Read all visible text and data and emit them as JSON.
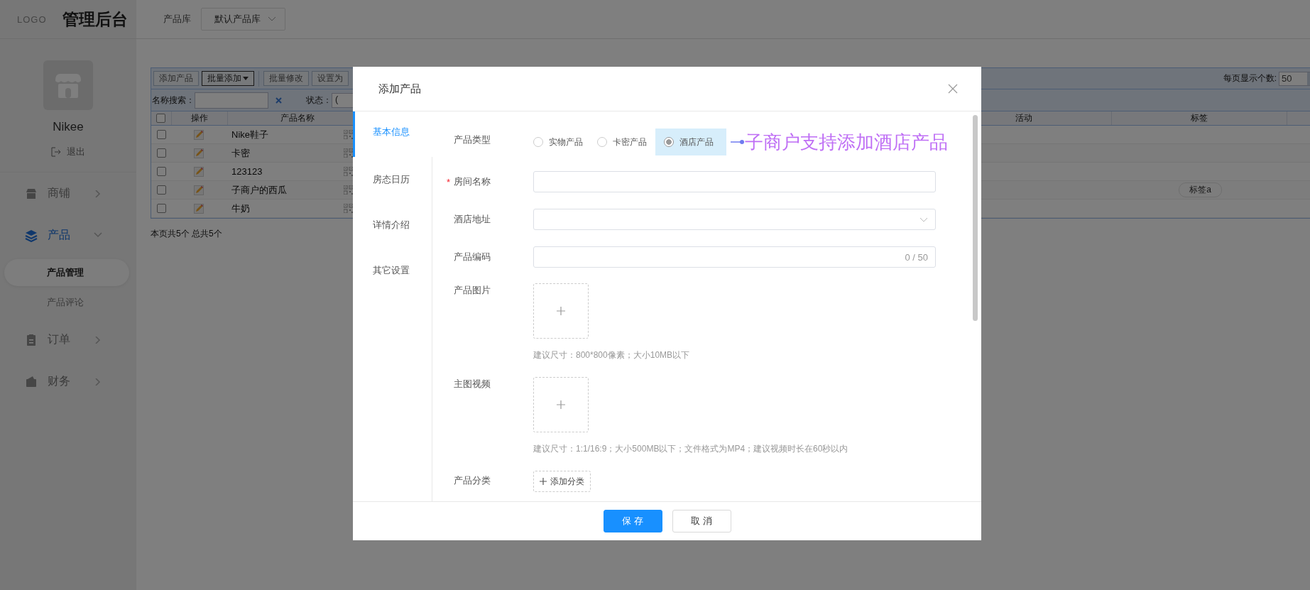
{
  "header": {
    "logo": "LOGO",
    "title": "管理后台",
    "library_label": "产品库",
    "library_select": "默认产品库"
  },
  "sidebar": {
    "shop_name": "Nikee",
    "logout": "退出",
    "menu": [
      {
        "label": "商铺",
        "selected": false,
        "expanded": false
      },
      {
        "label": "产品",
        "selected": true,
        "expanded": true,
        "children": [
          {
            "label": "产品管理",
            "selected": true
          },
          {
            "label": "产品评论",
            "selected": false
          }
        ]
      },
      {
        "label": "订单",
        "selected": false,
        "expanded": false
      },
      {
        "label": "财务",
        "selected": false,
        "expanded": false
      }
    ]
  },
  "toolbar": {
    "buttons": [
      {
        "label": "添加产品",
        "kind": "plain"
      },
      {
        "label": "批量添加",
        "kind": "dropdown"
      },
      {
        "label": "批量修改",
        "kind": "plain"
      },
      {
        "label": "设置为",
        "kind": "plain"
      }
    ],
    "page_size_label": "每页显示个数:",
    "page_size": "50"
  },
  "filters": {
    "name_label": "名称搜索：",
    "status_label": "状态：",
    "status_value": "("
  },
  "table": {
    "select_all_checked": false,
    "columns": [
      "操作",
      "产品名称",
      "活动",
      "标签"
    ],
    "rows": [
      {
        "checked": false,
        "name": "Nike鞋子"
      },
      {
        "checked": false,
        "name": "卡密"
      },
      {
        "checked": false,
        "name": "123123"
      },
      {
        "checked": false,
        "name": "子商户的西瓜",
        "tags": [
          "标签a"
        ]
      },
      {
        "checked": false,
        "name": "牛奶"
      }
    ],
    "summary": "本页共5个 总共5个"
  },
  "modal": {
    "title": "添加产品",
    "tabs": [
      {
        "label": "基本信息",
        "selected": true
      },
      {
        "label": "房态日历",
        "selected": false
      },
      {
        "label": "详情介绍",
        "selected": false
      },
      {
        "label": "其它设置",
        "selected": false
      }
    ],
    "fields": [
      {
        "kind": "radio",
        "label": "产品类型",
        "options": [
          {
            "label": "实物产品",
            "selected": false,
            "highlighted": false
          },
          {
            "label": "卡密产品",
            "selected": false,
            "highlighted": false
          },
          {
            "label": "酒店产品",
            "selected": true,
            "highlighted": true
          }
        ],
        "annotation": "子商户支持添加酒店产品"
      },
      {
        "kind": "text",
        "label": "房间名称",
        "required_mark": "*"
      },
      {
        "kind": "select",
        "label": "酒店地址"
      },
      {
        "kind": "counter",
        "label": "产品编码",
        "counter": "0 / 50"
      },
      {
        "kind": "upload",
        "label": "产品图片",
        "hint": "建议尺寸：800*800像素；大小10MB以下"
      },
      {
        "kind": "upload",
        "label": "主图视频",
        "hint": "建议尺寸：1:1/16:9；大小500MB以下；文件格式为MP4；建议视频时长在60秒以内"
      },
      {
        "kind": "button",
        "label": "产品分类",
        "button": "添加分类"
      }
    ],
    "buttons": [
      {
        "label": "保 存",
        "kind": "primary"
      },
      {
        "label": "取 消",
        "kind": "default"
      }
    ]
  }
}
